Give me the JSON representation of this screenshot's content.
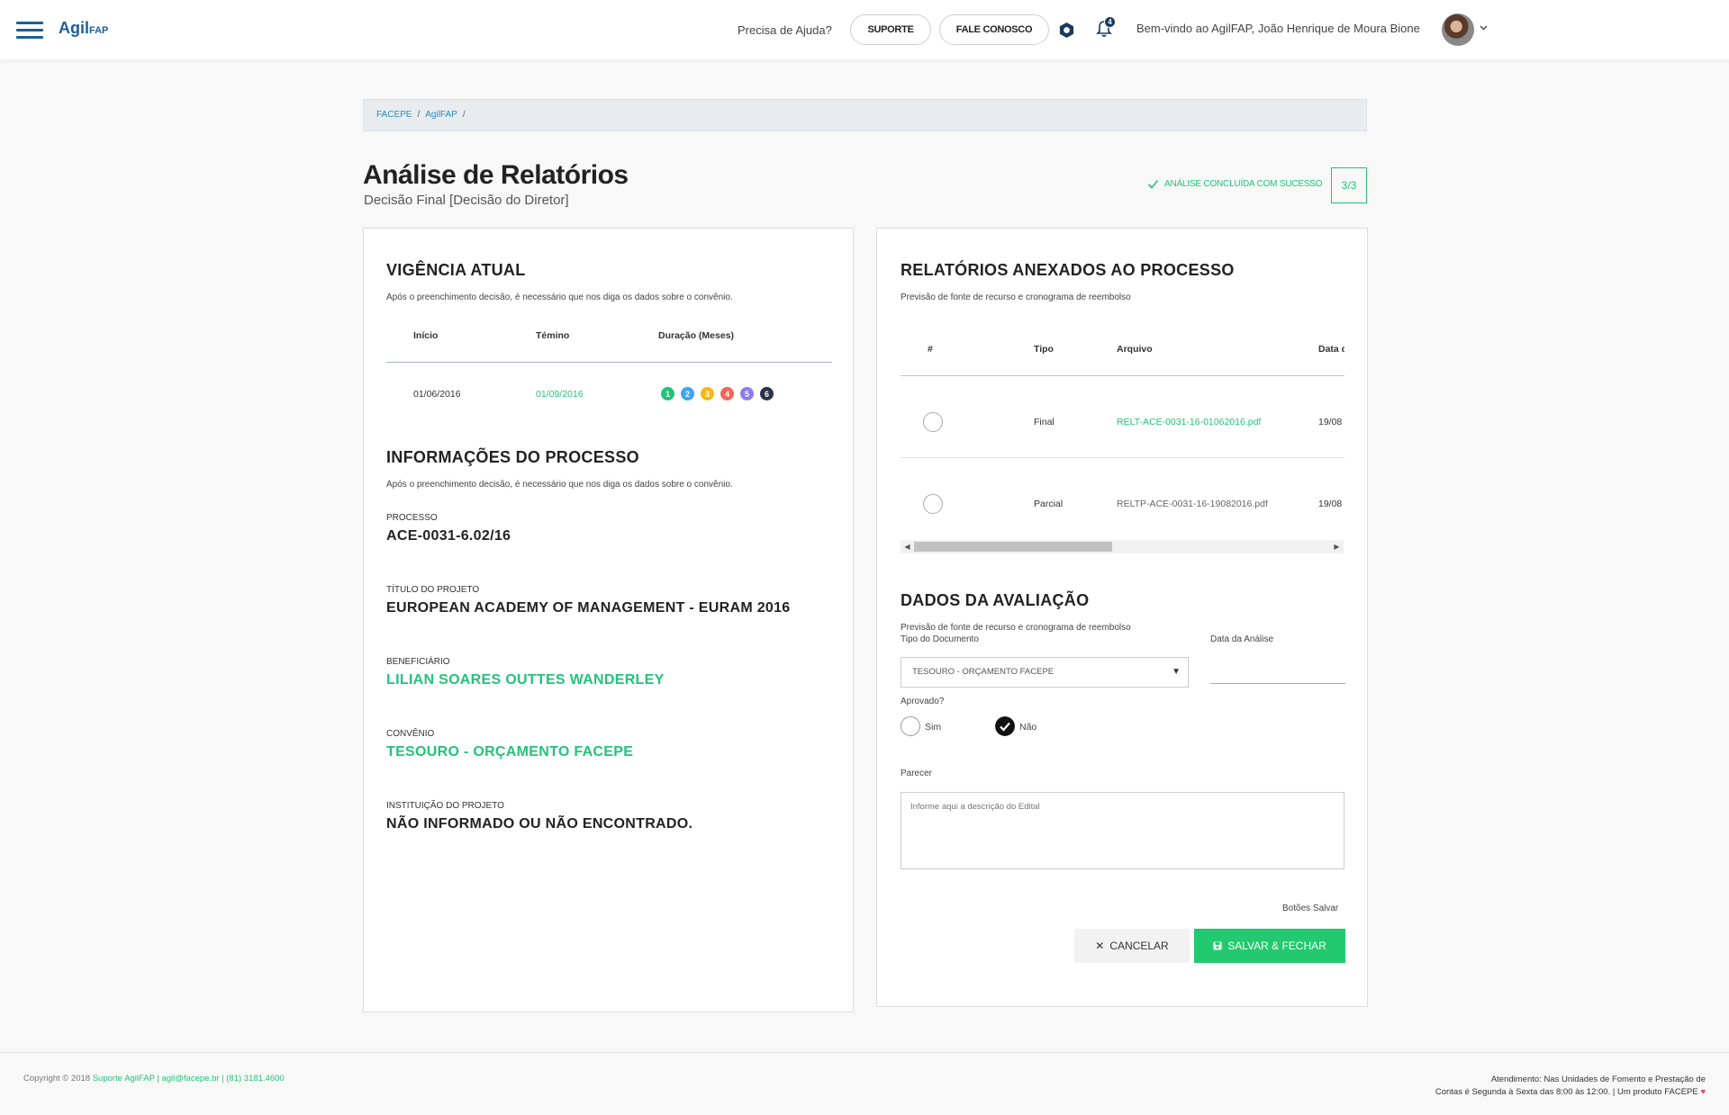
{
  "header": {
    "logo_main": "Agil",
    "logo_sub": "FAP",
    "help_text": "Precisa de Ajuda?",
    "support_label": "SUPORTE",
    "contact_label": "FALE CONOSCO",
    "notification_count": "4",
    "welcome": "Bem-vindo ao AgilFAP, João Henrique de Moura Bione"
  },
  "breadcrumb": {
    "items": [
      "FACEPE",
      "AgilFAP"
    ],
    "separator": "/"
  },
  "page": {
    "title": "Análise de Relatórios",
    "subtitle": "Decisão Final [Decisão do Diretor]",
    "status": "ANÁLISE CONCLUÍDA COM SUCESSO",
    "step": "3/3"
  },
  "vigencia": {
    "title": "VIGÊNCIA ATUAL",
    "desc": "Após o preenchimento decisão, é necessário que nos diga os dados sobre o convênio.",
    "headers": [
      "Início",
      "Témino",
      "Duração (Meses)"
    ],
    "inicio": "01/06/2016",
    "termino": "01/09/2016",
    "duracao": [
      {
        "n": "1",
        "color": "#22c37a"
      },
      {
        "n": "2",
        "color": "#3aa6f0"
      },
      {
        "n": "3",
        "color": "#f5b914"
      },
      {
        "n": "4",
        "color": "#f2645a"
      },
      {
        "n": "5",
        "color": "#8c7cf0"
      },
      {
        "n": "6",
        "color": "#2b3346"
      }
    ]
  },
  "processo": {
    "title": "INFORMAÇÕES DO PROCESSO",
    "desc": "Após o preenchimento decisão, é necessário que nos diga os dados sobre o convênio.",
    "fields": [
      {
        "label": "PROCESSO",
        "value": "ACE-0031-6.02/16"
      },
      {
        "label": "TÍTULO DO PROJETO",
        "value": "EUROPEAN ACADEMY OF MANAGEMENT - EURAM 2016"
      },
      {
        "label": "BENEFICIÁRIO",
        "value": "LILIAN SOARES OUTTES WANDERLEY"
      },
      {
        "label": "CONVÊNIO",
        "value": "TESOURO - ORÇAMENTO FACEPE"
      },
      {
        "label": "INSTITUIÇÃO DO PROJETO",
        "value": "NÃO INFORMADO OU NÃO ENCONTRADO."
      }
    ]
  },
  "relatorios": {
    "title": "RELATÓRIOS ANEXADOS AO PROCESSO",
    "desc": "Previsão de fonte de recurso e cronograma de reembolso",
    "headers": [
      "#",
      "Tipo",
      "Arquivo",
      "Data d"
    ],
    "rows": [
      {
        "tipo": "Final",
        "arquivo": "RELT-ACE-0031-16-01062016.pdf",
        "data": "19/08"
      },
      {
        "tipo": "Parcial",
        "arquivo": "RELTP-ACE-0031-16-19082016.pdf",
        "data": "19/08"
      }
    ]
  },
  "avaliacao": {
    "title": "DADOS DA AVALIAÇÃO",
    "desc": "Previsão de fonte de recurso e cronograma de reembolso",
    "tipo_label": "Tipo do Documento",
    "tipo_value": "TESOURO - ORÇAMENTO FACEPE",
    "data_label": "Data da Análise",
    "aprovado_label": "Aprovado?",
    "opt_sim": "Sim",
    "opt_nao": "Não",
    "selected": "Não",
    "parecer_label": "Parecer",
    "parecer_placeholder": "Informe aqui a descrição do Edital",
    "buttons_label": "Botões Salvar",
    "cancel_label": "CANCELAR",
    "save_label": "SALVAR & FECHAR"
  },
  "footer": {
    "copyright": "Copyright © 2018",
    "links": "Suporte AgilFAP | agil@facepe.br | (81) 3181.4600",
    "atendimento_1": "Atendimento: Nas Unidades de Fomento e Prestação de",
    "atendimento_2": "Contas é Segunda à Sexta das 8:00 às 12:00. | Um produto FACEPE"
  },
  "colors": {
    "brand": "#1a5f99",
    "accent_green": "#22c37a",
    "save_green": "#22c96e"
  }
}
